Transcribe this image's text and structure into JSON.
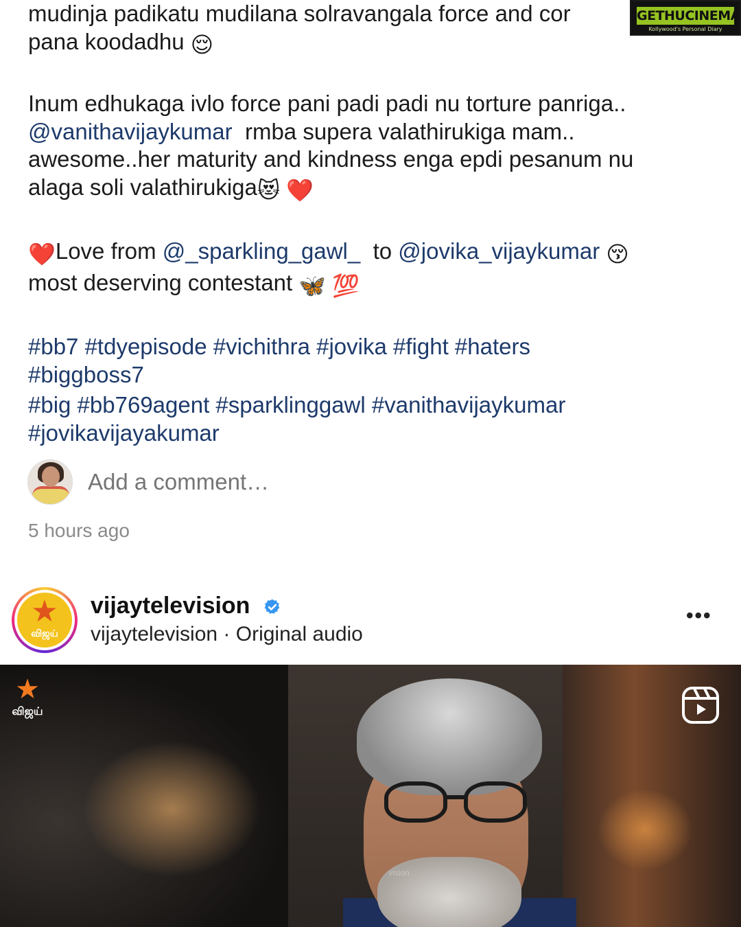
{
  "caption": {
    "line1": "mudinja padikatu mudilana solravangala force and cor",
    "line2_text": "pana koodadhu",
    "line2_emoji": "😌",
    "para2_line1": "Inum edhukaga ivlo force pani padi padi nu torture panriga..",
    "para2_mention": "@vanithavijaykumar",
    "para2_line2_rest": "rmba supera valathirukiga mam..",
    "para2_line3": "awesome..her maturity and kindness enga epdi pesanum nu",
    "para2_line4_text": "alaga soli valathirukiga",
    "para2_line4_emojis": "😻 ❤️",
    "love_emoji": "❤️",
    "love_text": "Love from",
    "love_mention1": "@_sparkling_gawl_",
    "love_to": "to",
    "love_mention2": "@jovika_vijaykumar",
    "love_emoji2": "😚",
    "deserving_text": "most deserving contestant",
    "deserving_emojis": "🦋 💯",
    "hashtags_line1": "#bb7 #tdyepisode #vichithra #jovika #fight #haters",
    "hashtags_line2": "#biggboss7",
    "hashtags_line3": "#big #bb769agent #sparklinggawl #vanithavijaykumar",
    "hashtags_line4": "#jovikavijayakumar"
  },
  "watermark": {
    "brand": "GETHUCINEMA",
    "tagline": "Kollywood's Personal Diary"
  },
  "comment": {
    "placeholder": "Add a comment…"
  },
  "timestamp": "5 hours ago",
  "post": {
    "username": "vijaytelevision",
    "verified": true,
    "subline": "vijaytelevision · Original audio",
    "logo_text": "விஜய்",
    "more_label": "•••",
    "video_channel_text": "விஜய்",
    "video_watermark": "vision"
  },
  "colors": {
    "link": "#1d3a6b",
    "verified_blue": "#3797f0",
    "watermark_green": "#95c321"
  },
  "icons": {
    "verified": "verified-badge-icon",
    "reels": "reels-icon",
    "more": "more-options-icon"
  }
}
